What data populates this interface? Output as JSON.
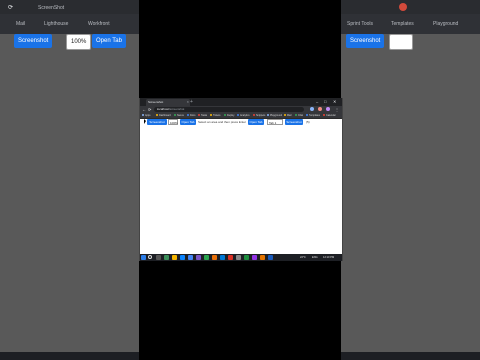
{
  "background": {
    "left_tab_title": "ScreenShot",
    "left_button": "Screenshot",
    "left_select_value": "100%",
    "left_button2": "Open Tab",
    "right_button": "Screenshot",
    "bookmarks_left": [
      "Mail",
      "Lighthouse",
      "Workfront"
    ],
    "bookmarks_right": [
      "Sprint Tools",
      "Templates",
      "Playground"
    ]
  },
  "browser": {
    "tab_title": "Screenshot",
    "tab2_title": "New Tab",
    "address": {
      "host": "localhost",
      "path": "/screenshot"
    },
    "bookmarks": [
      "Apps",
      "Dashboard",
      "Nexus",
      "Docs",
      "Tasks",
      "Tickets",
      "Deploy",
      "Analytics",
      "Snippets",
      "Playground",
      "Mail",
      "Chat",
      "Templates",
      "Calendar"
    ]
  },
  "page": {
    "screenshot_label": "Screenshot",
    "zoom_select": "100%",
    "open_tab_label": "Open Tab",
    "hint_text": "Select an area and then press Enter",
    "open_tab_label2": "Open Tab",
    "tab_select": "Tab 1",
    "screenshot_label2": "Screenshot",
    "extra_text": "(5)"
  },
  "taskbar": {
    "weather": "22°C",
    "language": "ENG",
    "time": "12:10 PM"
  },
  "colors": {
    "accent": "#1a73e8",
    "chrome_dark": "#35363a",
    "background_gray": "#595959"
  }
}
